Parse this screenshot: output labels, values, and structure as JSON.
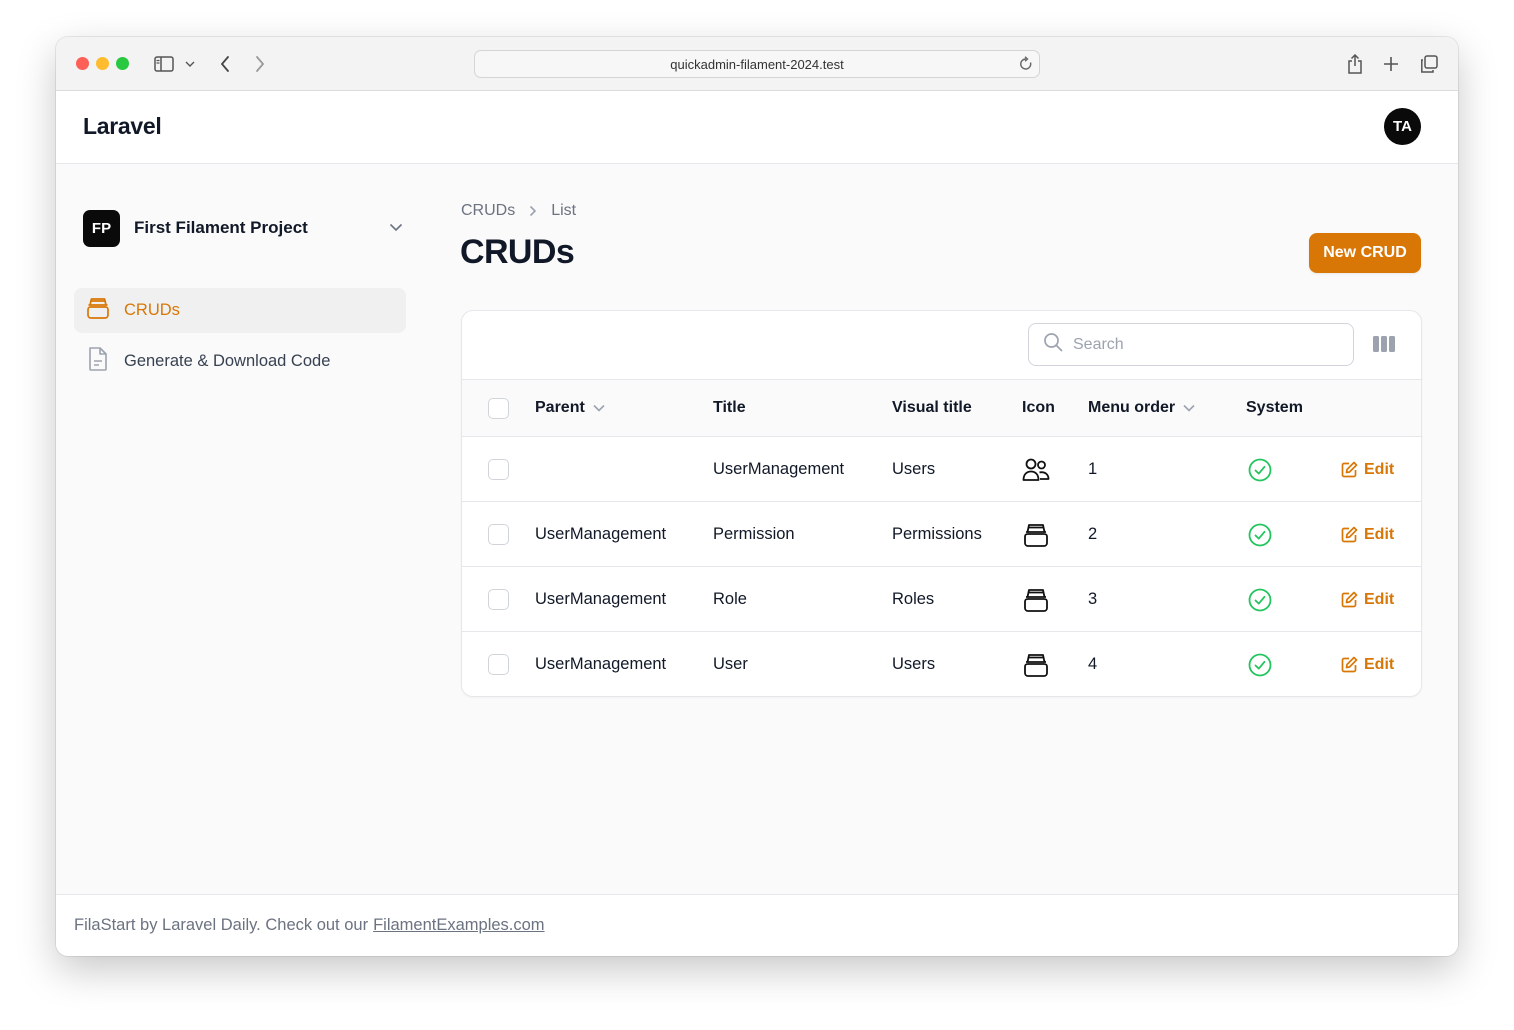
{
  "browser": {
    "url": "quickadmin-filament-2024.test",
    "icons": [
      "sidebar-toggle-icon",
      "chevron-down-icon",
      "back-icon",
      "forward-icon",
      "reload-icon",
      "share-icon",
      "new-tab-icon",
      "tabs-overview-icon"
    ]
  },
  "topbar": {
    "brand": "Laravel",
    "avatar_initials": "TA"
  },
  "sidebar": {
    "tenant": {
      "initials": "FP",
      "name": "First Filament Project"
    },
    "items": [
      {
        "label": "CRUDs",
        "icon": "archive-box-icon",
        "active": true
      },
      {
        "label": "Generate & Download Code",
        "icon": "document-icon",
        "active": false
      }
    ]
  },
  "main": {
    "breadcrumb": [
      "CRUDs",
      "List"
    ],
    "title": "CRUDs",
    "new_button": "New CRUD"
  },
  "table": {
    "search_placeholder": "Search",
    "columns": [
      "Parent",
      "Title",
      "Visual title",
      "Icon",
      "Menu order",
      "System"
    ],
    "edit_label": "Edit",
    "rows": [
      {
        "parent": "",
        "title": "UserManagement",
        "visual_title": "Users",
        "icon": "users-icon",
        "menu_order": "1",
        "system": true
      },
      {
        "parent": "UserManagement",
        "title": "Permission",
        "visual_title": "Permissions",
        "icon": "archive-box-icon",
        "menu_order": "2",
        "system": true
      },
      {
        "parent": "UserManagement",
        "title": "Role",
        "visual_title": "Roles",
        "icon": "archive-box-icon",
        "menu_order": "3",
        "system": true
      },
      {
        "parent": "UserManagement",
        "title": "User",
        "visual_title": "Users",
        "icon": "archive-box-icon",
        "menu_order": "4",
        "system": true
      }
    ]
  },
  "footer": {
    "text": "FilaStart by Laravel Daily. Check out our",
    "link": "FilamentExamples.com"
  },
  "colors": {
    "accent": "#d97706",
    "success": "#22c55e",
    "dark": "#0a0a0a"
  }
}
